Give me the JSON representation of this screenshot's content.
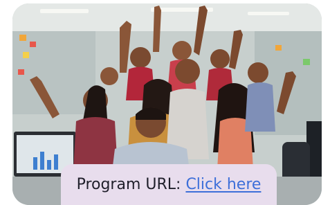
{
  "caption": {
    "label": "Program URL:",
    "link_text": "Click here"
  },
  "photo": {
    "alt": "Group of excited office workers celebrating with raised arms"
  },
  "colors": {
    "caption_background": "#e8dded",
    "link": "#3d6fd9",
    "text": "#1f1f2a"
  }
}
